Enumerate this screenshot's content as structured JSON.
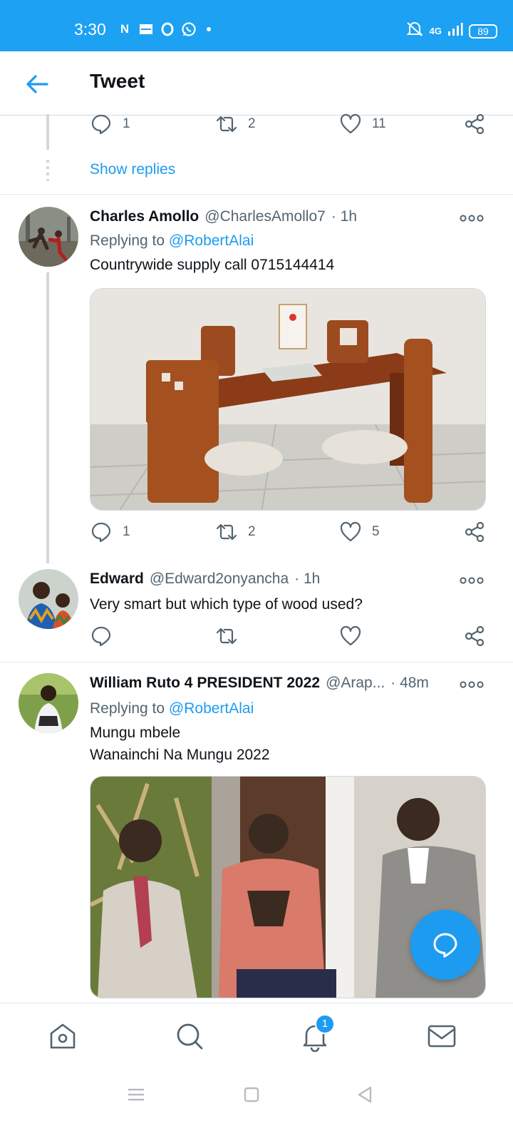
{
  "status_bar": {
    "time": "3:30",
    "battery": "89",
    "network": "4G"
  },
  "header": {
    "title": "Tweet",
    "back_icon": "arrow-left-icon"
  },
  "top_tweet_actions": {
    "reply_count": "1",
    "retweet_count": "2",
    "like_count": "11"
  },
  "show_replies_label": "Show replies",
  "tweets": [
    {
      "name": "Charles Amollo",
      "handle": "@CharlesAmollo7",
      "time": "· 1h",
      "replying_prefix": "Replying to",
      "replying_to": "@RobertAlai",
      "text": "Countrywide supply call 0715144414",
      "media": "dining-table-photo",
      "reply_count": "1",
      "retweet_count": "2",
      "like_count": "5"
    },
    {
      "name": "Edward",
      "handle": "@Edward2onyancha",
      "time": "· 1h",
      "text": "Very smart but which type of wood used?",
      "reply_count": "",
      "retweet_count": "",
      "like_count": ""
    },
    {
      "name": "William Ruto 4 PRESIDENT 2022",
      "handle": "@Arap...",
      "time": "· 48m",
      "replying_prefix": "Replying to",
      "replying_to": "@RobertAlai",
      "text_line1": "Mungu mbele",
      "text_line2": "Wanainchi Na Mungu 2022",
      "media": "three-men-photo"
    }
  ],
  "bottom_nav": {
    "items": [
      "home-icon",
      "search-icon",
      "notifications-icon",
      "messages-icon"
    ],
    "notification_badge": "1"
  },
  "colors": {
    "accent": "#1d9bf0",
    "status_bar": "#1da1f2",
    "secondary_text": "#536471"
  }
}
